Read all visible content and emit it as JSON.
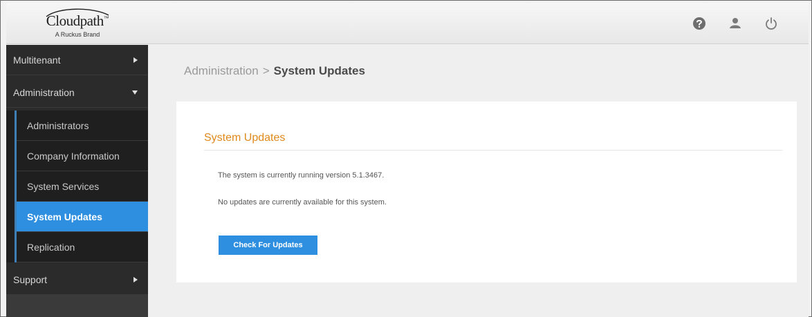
{
  "header": {
    "logo_text": "Cloudpath",
    "logo_tm": "™",
    "logo_subtitle": "A Ruckus Brand",
    "icons": [
      "help-icon",
      "user-icon",
      "power-icon"
    ]
  },
  "sidebar": {
    "items": [
      {
        "label": "Multitenant",
        "arrow": "right"
      },
      {
        "label": "Administration",
        "arrow": "down"
      }
    ],
    "admin_subitems": [
      {
        "label": "Administrators",
        "active": false
      },
      {
        "label": "Company Information",
        "active": false
      },
      {
        "label": "System Services",
        "active": false
      },
      {
        "label": "System Updates",
        "active": true
      },
      {
        "label": "Replication",
        "active": false
      }
    ],
    "support": {
      "label": "Support",
      "arrow": "right"
    }
  },
  "main": {
    "breadcrumb": {
      "parent": "Administration",
      "separator": ">",
      "current": "System Updates"
    },
    "card": {
      "title": "System Updates",
      "version_text": "The system is currently running version 5.1.3467.",
      "status_text": "No updates are currently available for this system.",
      "button_label": "Check For Updates"
    }
  },
  "colors": {
    "accent_blue": "#2e8fe0",
    "title_orange": "#e0891b",
    "sidebar_bg": "#2b2b2b"
  }
}
